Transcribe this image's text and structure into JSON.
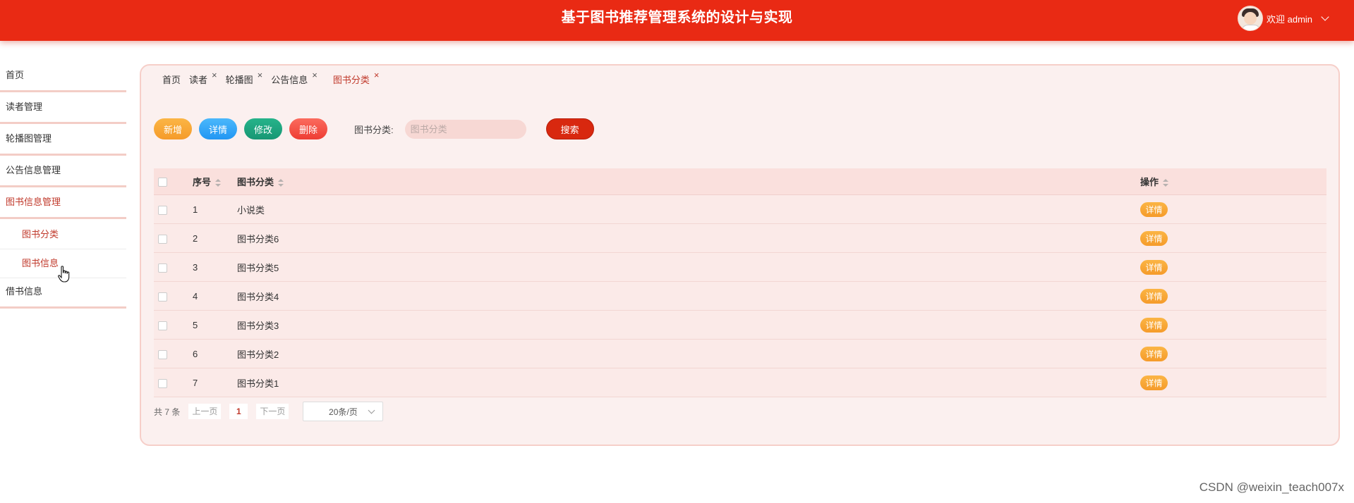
{
  "header": {
    "title": "基于图书推荐管理系统的设计与实现",
    "welcome": "欢迎 admin"
  },
  "sidebar": {
    "items": [
      {
        "label": "首页"
      },
      {
        "label": "读者管理"
      },
      {
        "label": "轮播图管理"
      },
      {
        "label": "公告信息管理"
      },
      {
        "label": "图书信息管理"
      },
      {
        "label": "借书信息"
      }
    ],
    "submenu": [
      {
        "label": "图书分类"
      },
      {
        "label": "图书信息"
      }
    ]
  },
  "tabs": [
    {
      "label": "首页",
      "close": ""
    },
    {
      "label": "读者",
      "close": "×"
    },
    {
      "label": "轮播图",
      "close": "×"
    },
    {
      "label": "公告信息",
      "close": "×"
    },
    {
      "label": "图书分类",
      "close": "×"
    }
  ],
  "toolbar": {
    "add": "新增",
    "detail": "详情",
    "edit": "修改",
    "delete": "删除",
    "filter_label": "图书分类:",
    "filter_placeholder": "图书分类",
    "search": "搜索"
  },
  "table": {
    "headers": {
      "index": "序号",
      "category": "图书分类",
      "ops": "操作"
    },
    "detail_label": "详情",
    "rows": [
      {
        "index": "1",
        "category": "小说类"
      },
      {
        "index": "2",
        "category": "图书分类6"
      },
      {
        "index": "3",
        "category": "图书分类5"
      },
      {
        "index": "4",
        "category": "图书分类4"
      },
      {
        "index": "5",
        "category": "图书分类3"
      },
      {
        "index": "6",
        "category": "图书分类2"
      },
      {
        "index": "7",
        "category": "图书分类1"
      }
    ]
  },
  "pagination": {
    "total": "共 7 条",
    "prev": "上一页",
    "current": "1",
    "next": "下一页",
    "page_size": "20条/页"
  },
  "watermark": "CSDN @weixin_teach007x",
  "colors": {
    "header": "#e92a14",
    "accent": "#c0392b",
    "panel_bg": "#fbf0ef"
  }
}
